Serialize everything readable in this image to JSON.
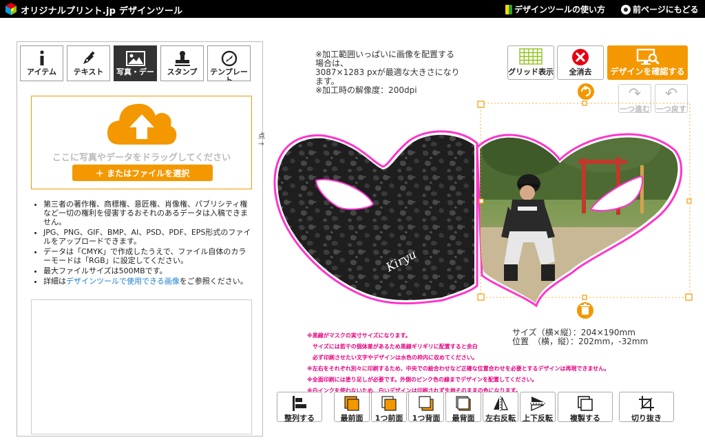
{
  "header": {
    "logo_text": "オリジナルプリント.jp デザインツール",
    "guide_link": "デザインツールの使い方",
    "back_link": "前ページにもどる"
  },
  "left_panel": {
    "tabs": [
      {
        "label": "アイテム",
        "icon": "info-icon"
      },
      {
        "label": "テキスト",
        "icon": "pen-icon"
      },
      {
        "label": "写真・デー",
        "icon": "image-icon",
        "active": true
      },
      {
        "label": "スタンプ",
        "icon": "stamp-icon"
      },
      {
        "label": "テンプレート",
        "icon": "template-icon"
      }
    ],
    "upload": {
      "drop_text": "ここに写真やデータをドラッグしてください",
      "file_button": "＋ またはファイルを選択"
    },
    "notes": [
      "第三者の著作権、商標権、意匠権、肖像権、パブリシティ権など一切の権利を侵害するおそれのあるデータは入稿できません。",
      "JPG、PNG、GIF、BMP、AI、PSD、PDF、EPS形式のファイルをアップロードできます。",
      "データは「CMYK」で作成したうえで、ファイル自体のカラーモードは「RGB」に設定してください。",
      "最大ファイルサイズは500MBです。"
    ],
    "detail_note": {
      "prefix": "詳細は",
      "link": "デザインツールで使用できる画像",
      "suffix": "をご参照ください。"
    }
  },
  "canvas": {
    "info_lines": [
      "※加工範囲いっぱいに画像を配置する",
      "場合は、",
      "3087×1283 pxが最適な大きさになり",
      "ます。",
      "※加工時の解像度：200dpi"
    ],
    "origin_label": "点",
    "origin_arrow": "→",
    "text_on_mask": "Kiryu",
    "size_label": "サイズ（横×縦）：204×190mm",
    "position_label": "位置　（横，縦）：202mm，-32mm",
    "pink_notes": [
      "※黒線がマスクの実寸サイズになります。",
      "サイズには若干の個体差があるため黒線ギリギリに配置すると余白",
      "必ず印刷させたい文字やデザインは水色の枠内に収めてください。",
      "※左右をそれぞれ別々に印刷するため、中央での絵合わせなど正確な位置合わせを必要とするデザインは再現できません。",
      "※全面印刷には塗り足しが必要です。外側のピンク色の線までデザインを配置してください。",
      "※白インクを使わないため、白いデザインは印刷されず生地そのままの色になります。"
    ]
  },
  "top_buttons": {
    "grid": "グリッド表示",
    "clear": "全消去",
    "confirm": "デザインを確認する"
  },
  "history_buttons": {
    "redo": "一つ進む",
    "undo": "一つ戻す"
  },
  "bottom_buttons": [
    {
      "label": "整列する",
      "icon": "align-icon"
    },
    {
      "label": "最前面",
      "icon": "bring-to-front-icon"
    },
    {
      "label": "1つ前面",
      "icon": "bring-forward-icon"
    },
    {
      "label": "1つ背面",
      "icon": "send-backward-icon"
    },
    {
      "label": "最背面",
      "icon": "send-to-back-icon"
    },
    {
      "label": "左右反転",
      "icon": "flip-horizontal-icon"
    },
    {
      "label": "上下反転",
      "icon": "flip-vertical-icon"
    },
    {
      "label": "複製する",
      "icon": "duplicate-icon"
    },
    {
      "label": "切り抜き",
      "icon": "crop-icon"
    }
  ],
  "colors": {
    "accent": "#f39800",
    "pink": "#e4007f",
    "link": "#1a7fd4",
    "header_bg": "#000000"
  }
}
